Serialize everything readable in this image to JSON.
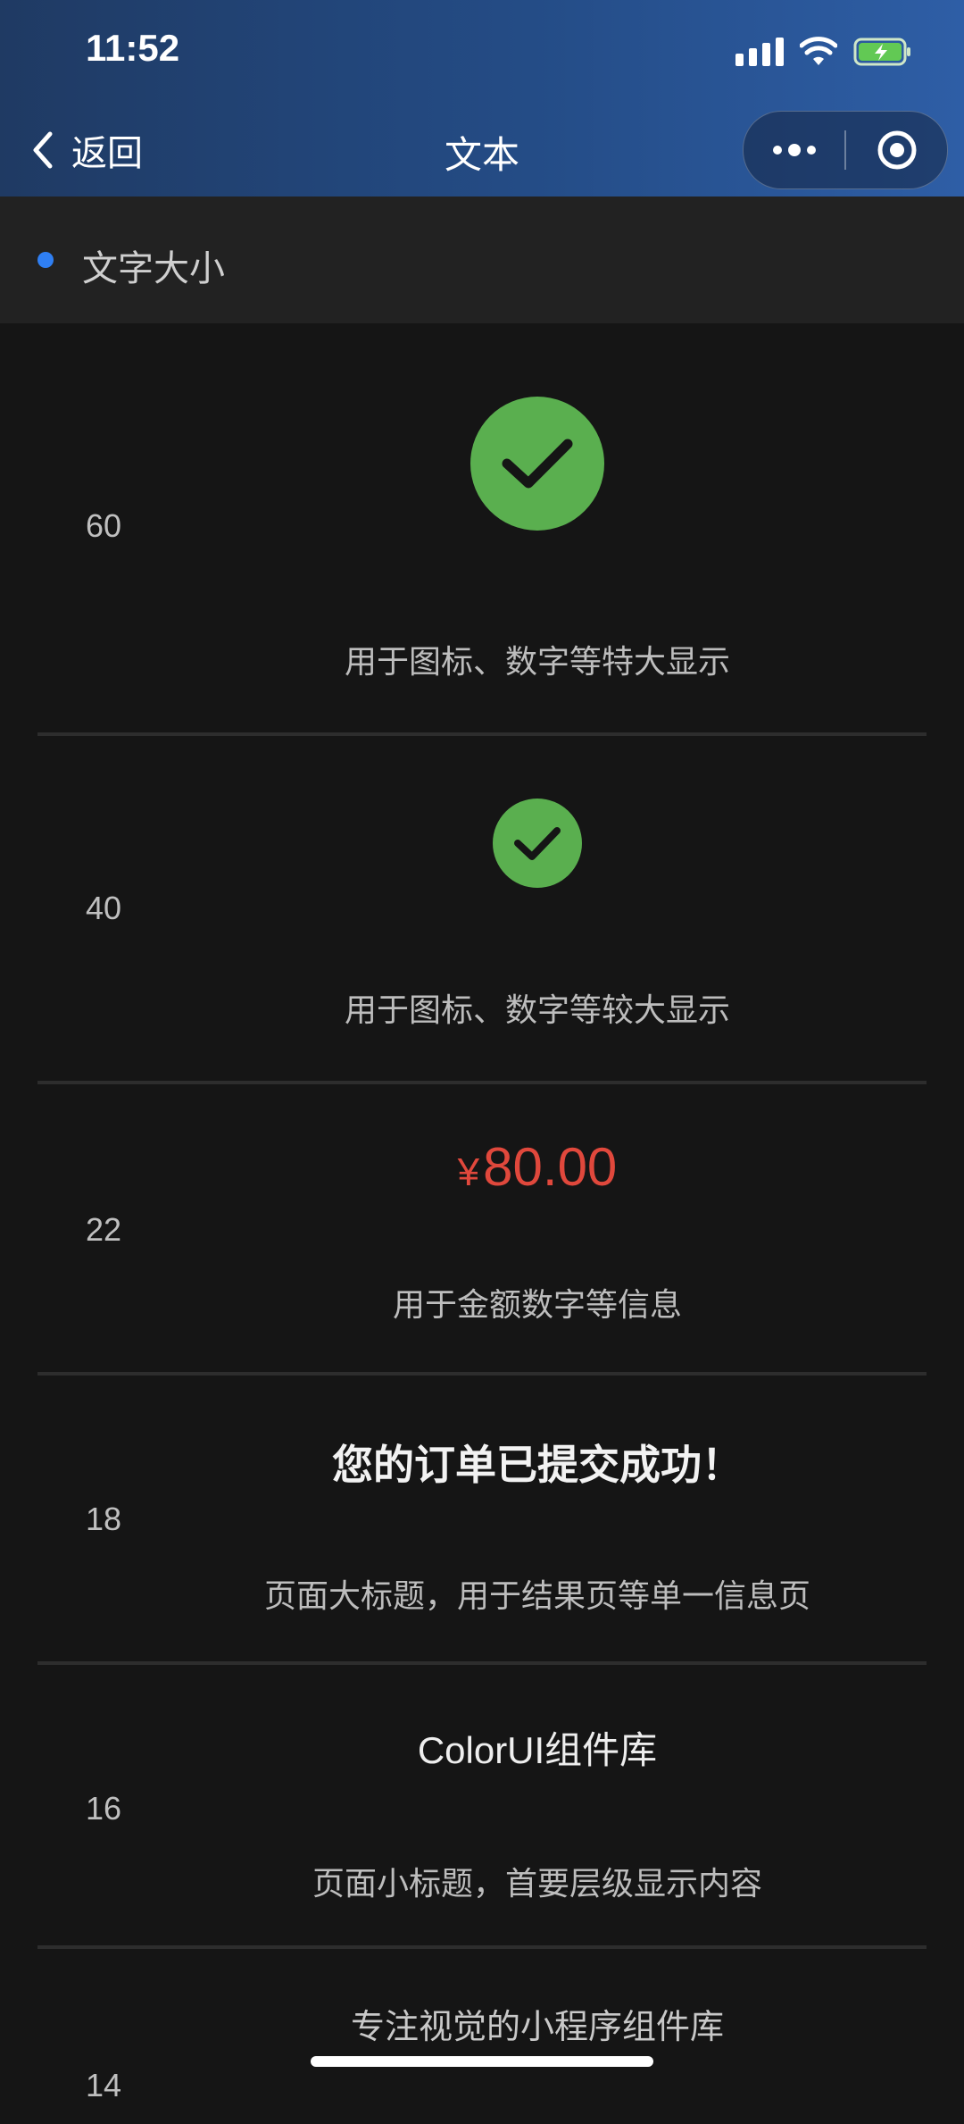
{
  "status_bar": {
    "time": "11:52"
  },
  "nav": {
    "back_label": "返回",
    "title": "文本"
  },
  "section": {
    "title": "文字大小"
  },
  "rows": [
    {
      "size": "60",
      "desc": "用于图标、数字等特大显示"
    },
    {
      "size": "40",
      "desc": "用于图标、数字等较大显示"
    },
    {
      "size": "22",
      "price_symbol": "¥",
      "price_value": "80.00",
      "desc": "用于金额数字等信息"
    },
    {
      "size": "18",
      "headline": "您的订单已提交成功！",
      "desc": "页面大标题，用于结果页等单一信息页"
    },
    {
      "size": "16",
      "headline": "ColorUI组件库",
      "desc": "页面小标题，首要层级显示内容"
    },
    {
      "size": "14",
      "headline": "专注视觉的小程序组件库"
    }
  ],
  "colors": {
    "accent_blue": "#2f7ff3",
    "success_green": "#5aaf4f",
    "price_red": "#e0483c",
    "header_gradient_start": "#1f3a63",
    "header_gradient_end": "#2e5ea6"
  },
  "icons": [
    "back-chevron-icon",
    "more-dots-icon",
    "target-circle-icon",
    "check-icon",
    "wifi-icon",
    "cellular-signal-icon",
    "battery-charging-icon"
  ]
}
